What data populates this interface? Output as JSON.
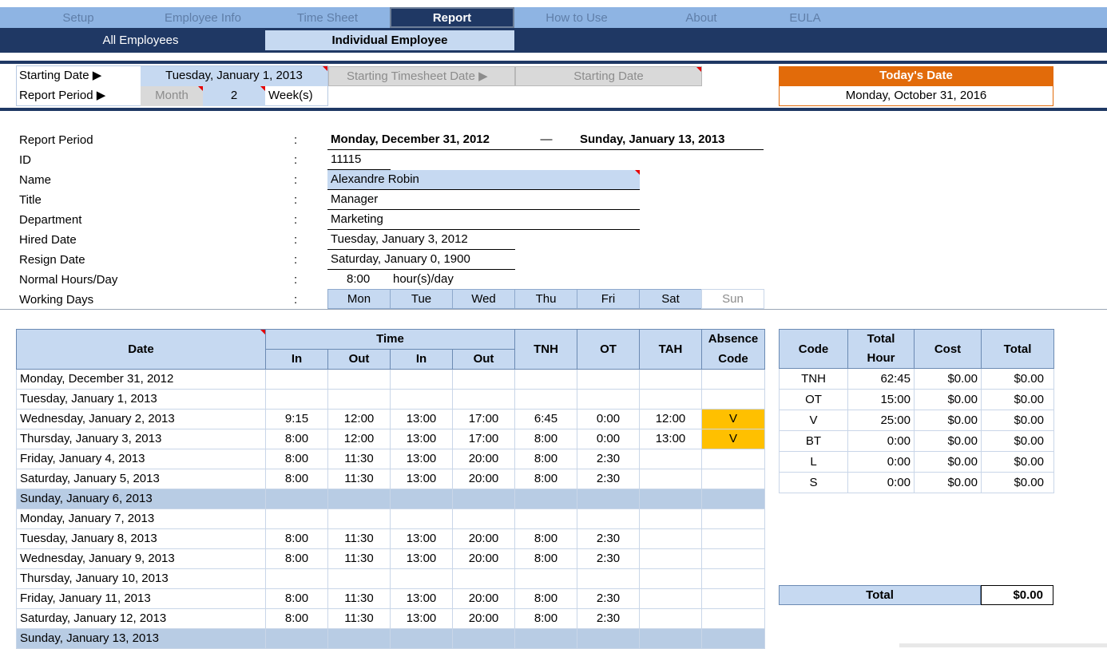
{
  "nav": {
    "tabs": [
      "Setup",
      "Employee Info",
      "Time Sheet",
      "Report",
      "How to Use",
      "About",
      "EULA"
    ],
    "subtabs": [
      "All Employees",
      "Individual Employee"
    ]
  },
  "controls": {
    "starting_date_label": "Starting Date ▶",
    "starting_date_value": "Tuesday, January 1, 2013",
    "starting_ts_label": "Starting Timesheet Date ▶",
    "starting_ts_value": "Starting Date",
    "report_period_label": "Report Period ▶",
    "period_unit": "Month",
    "period_count": "2",
    "period_suffix": "Week(s)"
  },
  "today": {
    "label": "Today's Date",
    "value": "Monday, October 31, 2016"
  },
  "info": {
    "colon": ":",
    "labels": [
      "Report Period",
      "ID",
      "Name",
      "Title",
      "Department",
      "Hired Date",
      "Resign Date",
      "Normal Hours/Day",
      "Working Days"
    ],
    "period_start": "Monday, December 31, 2012",
    "period_dash": "—",
    "period_end": "Sunday, January 13, 2013",
    "id": "11115",
    "name": "Alexandre Robin",
    "title": "Manager",
    "department": "Marketing",
    "hired": "Tuesday, January 3, 2012",
    "resign": "Saturday, January 0, 1900",
    "hours": "8:00",
    "hours_unit": "hour(s)/day",
    "working_days": [
      "Mon",
      "Tue",
      "Wed",
      "Thu",
      "Fri",
      "Sat",
      "Sun"
    ]
  },
  "timesheet": {
    "headers": {
      "date": "Date",
      "time": "Time",
      "in": "In",
      "out": "Out",
      "tnh": "TNH",
      "ot": "OT",
      "tah": "TAH",
      "absence": "Absence",
      "code": "Code"
    },
    "rows": [
      {
        "date": "Monday, December 31, 2012",
        "in1": "",
        "out1": "",
        "in2": "",
        "out2": "",
        "tnh": "",
        "ot": "",
        "tah": "",
        "abs": ""
      },
      {
        "date": "Tuesday, January 1, 2013",
        "in1": "",
        "out1": "",
        "in2": "",
        "out2": "",
        "tnh": "",
        "ot": "",
        "tah": "",
        "abs": ""
      },
      {
        "date": "Wednesday, January 2, 2013",
        "in1": "9:15",
        "out1": "12:00",
        "in2": "13:00",
        "out2": "17:00",
        "tnh": "6:45",
        "ot": "0:00",
        "tah": "12:00",
        "abs": "V"
      },
      {
        "date": "Thursday, January 3, 2013",
        "in1": "8:00",
        "out1": "12:00",
        "in2": "13:00",
        "out2": "17:00",
        "tnh": "8:00",
        "ot": "0:00",
        "tah": "13:00",
        "abs": "V"
      },
      {
        "date": "Friday, January 4, 2013",
        "in1": "8:00",
        "out1": "11:30",
        "in2": "13:00",
        "out2": "20:00",
        "tnh": "8:00",
        "ot": "2:30",
        "tah": "",
        "abs": ""
      },
      {
        "date": "Saturday, January 5, 2013",
        "in1": "8:00",
        "out1": "11:30",
        "in2": "13:00",
        "out2": "20:00",
        "tnh": "8:00",
        "ot": "2:30",
        "tah": "",
        "abs": ""
      },
      {
        "date": "Sunday, January 6, 2013",
        "in1": "",
        "out1": "",
        "in2": "",
        "out2": "",
        "tnh": "",
        "ot": "",
        "tah": "",
        "abs": ""
      },
      {
        "date": "Monday, January 7, 2013",
        "in1": "",
        "out1": "",
        "in2": "",
        "out2": "",
        "tnh": "",
        "ot": "",
        "tah": "",
        "abs": ""
      },
      {
        "date": "Tuesday, January 8, 2013",
        "in1": "8:00",
        "out1": "11:30",
        "in2": "13:00",
        "out2": "20:00",
        "tnh": "8:00",
        "ot": "2:30",
        "tah": "",
        "abs": ""
      },
      {
        "date": "Wednesday, January 9, 2013",
        "in1": "8:00",
        "out1": "11:30",
        "in2": "13:00",
        "out2": "20:00",
        "tnh": "8:00",
        "ot": "2:30",
        "tah": "",
        "abs": ""
      },
      {
        "date": "Thursday, January 10, 2013",
        "in1": "",
        "out1": "",
        "in2": "",
        "out2": "",
        "tnh": "",
        "ot": "",
        "tah": "",
        "abs": ""
      },
      {
        "date": "Friday, January 11, 2013",
        "in1": "8:00",
        "out1": "11:30",
        "in2": "13:00",
        "out2": "20:00",
        "tnh": "8:00",
        "ot": "2:30",
        "tah": "",
        "abs": ""
      },
      {
        "date": "Saturday, January 12, 2013",
        "in1": "8:00",
        "out1": "11:30",
        "in2": "13:00",
        "out2": "20:00",
        "tnh": "8:00",
        "ot": "2:30",
        "tah": "",
        "abs": ""
      },
      {
        "date": "Sunday, January 13, 2013",
        "in1": "",
        "out1": "",
        "in2": "",
        "out2": "",
        "tnh": "",
        "ot": "",
        "tah": "",
        "abs": ""
      }
    ]
  },
  "summary": {
    "headers": {
      "code": "Code",
      "total_hour_1": "Total",
      "total_hour_2": "Hour",
      "cost": "Cost",
      "total": "Total"
    },
    "rows": [
      {
        "code": "TNH",
        "hour": "62:45",
        "cost": "$0.00",
        "total": "$0.00"
      },
      {
        "code": "OT",
        "hour": "15:00",
        "cost": "$0.00",
        "total": "$0.00"
      },
      {
        "code": "V",
        "hour": "25:00",
        "cost": "$0.00",
        "total": "$0.00"
      },
      {
        "code": "BT",
        "hour": "0:00",
        "cost": "$0.00",
        "total": "$0.00"
      },
      {
        "code": "L",
        "hour": "0:00",
        "cost": "$0.00",
        "total": "$0.00"
      },
      {
        "code": "S",
        "hour": "0:00",
        "cost": "$0.00",
        "total": "$0.00"
      }
    ],
    "grand_label": "Total",
    "grand_value": "$0.00"
  }
}
